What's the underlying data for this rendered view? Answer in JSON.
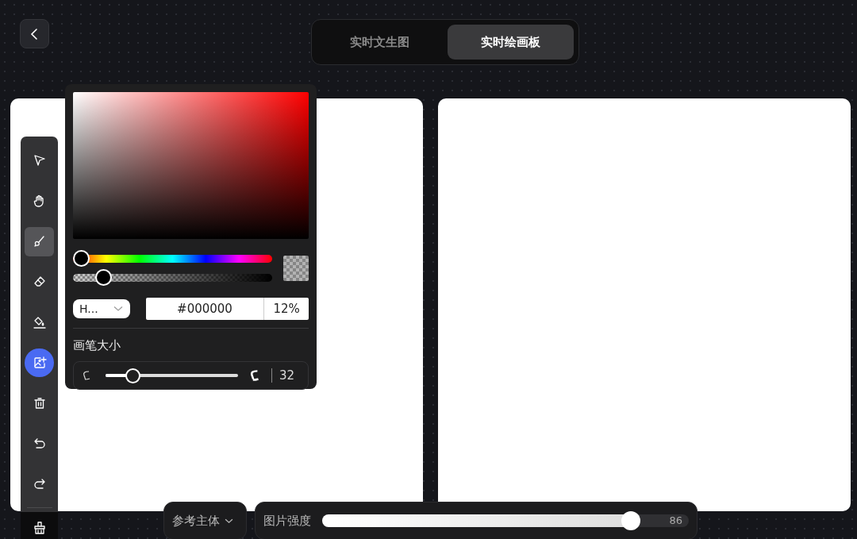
{
  "tabs": [
    {
      "label": "实时文生图",
      "selected": false
    },
    {
      "label": "实时绘画板",
      "selected": true
    }
  ],
  "tools": [
    {
      "kind": "select",
      "selected": false
    },
    {
      "kind": "hand",
      "selected": false
    },
    {
      "kind": "brush",
      "selected": true
    },
    {
      "kind": "eraser",
      "selected": false
    },
    {
      "kind": "fill",
      "selected": false
    },
    {
      "kind": "add-image",
      "selected": false
    },
    {
      "kind": "delete",
      "selected": false
    },
    {
      "kind": "undo",
      "selected": false
    },
    {
      "kind": "redo",
      "selected": false
    },
    {
      "kind": "clear",
      "selected": false
    }
  ],
  "color_picker": {
    "hue": {
      "level": 0
    },
    "alpha": {
      "level": 0.12
    },
    "format": "H...",
    "hex": "#000000",
    "alpha_text": "12%",
    "brush_size_label": "画笔大小",
    "brush_size": {
      "level": 0.17
    },
    "brush_size_value": "32"
  },
  "bottom_bar": {
    "dropdown": "参考主体",
    "strength_label": "图片强度",
    "strength": {
      "level": 0.86
    },
    "strength_value": "86"
  }
}
